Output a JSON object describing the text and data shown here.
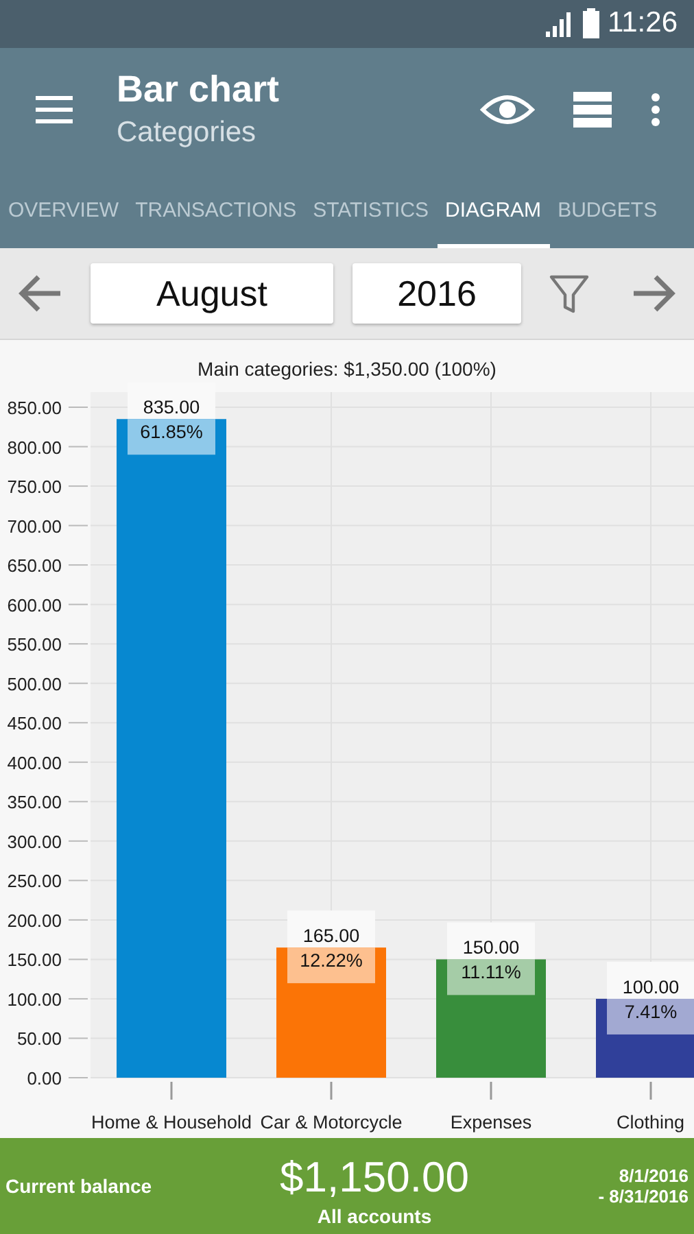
{
  "status_bar": {
    "time": "11:26"
  },
  "app_bar": {
    "title": "Bar chart",
    "subtitle": "Categories"
  },
  "tabs": [
    {
      "label": "OVERVIEW",
      "selected": false
    },
    {
      "label": "TRANSACTIONS",
      "selected": false
    },
    {
      "label": "STATISTICS",
      "selected": false
    },
    {
      "label": "DIAGRAM",
      "selected": true
    },
    {
      "label": "BUDGETS",
      "selected": false
    }
  ],
  "period": {
    "month": "August",
    "year": "2016"
  },
  "chart": {
    "chart_data": {
      "type": "bar",
      "title": "Main categories: $1,350.00 (100%)",
      "categories": [
        "Home & Household",
        "Car & Motorcycle",
        "Expenses",
        "Clothing"
      ],
      "grid": true,
      "series": [
        {
          "values": [
            835,
            165,
            150,
            100
          ],
          "colors": [
            "#0788d0",
            "#fb7406",
            "#388e3c",
            "#30409a"
          ]
        }
      ],
      "ylim": [
        0,
        850
      ],
      "yticks": [
        {
          "value": 0,
          "label": "0.00"
        },
        {
          "value": 50,
          "label": "50.00"
        },
        {
          "value": 100,
          "label": "100.00"
        },
        {
          "value": 150,
          "label": "150.00"
        },
        {
          "value": 200,
          "label": "200.00"
        },
        {
          "value": 250,
          "label": "250.00"
        },
        {
          "value": 300,
          "label": "300.00"
        },
        {
          "value": 350,
          "label": "350.00"
        },
        {
          "value": 400,
          "label": "400.00"
        },
        {
          "value": 450,
          "label": "450.00"
        },
        {
          "value": 500,
          "label": "500.00"
        },
        {
          "value": 550,
          "label": "550.00"
        },
        {
          "value": 600,
          "label": "600.00"
        },
        {
          "value": 650,
          "label": "650.00"
        },
        {
          "value": 700,
          "label": "700.00"
        },
        {
          "value": 750,
          "label": "750.00"
        },
        {
          "value": 800,
          "label": "800.00"
        },
        {
          "value": 850,
          "label": "850.00"
        }
      ],
      "value_labels": [
        "835.00",
        "165.00",
        "150.00",
        "100.00"
      ],
      "annotations": [
        {
          "x": "Home & Household",
          "y": 835,
          "text": "61.85%"
        },
        {
          "x": "Car & Motorcycle",
          "y": 165,
          "text": "12.22%"
        },
        {
          "x": "Expenses",
          "y": 150,
          "text": "11.11%"
        },
        {
          "x": "Clothing",
          "y": 100,
          "text": "7.41%"
        }
      ]
    }
  },
  "footer": {
    "label": "Current balance",
    "amount": "$1,150.00",
    "accounts": "All accounts",
    "date_from": "8/1/2016",
    "date_to": "- 8/31/2016"
  }
}
